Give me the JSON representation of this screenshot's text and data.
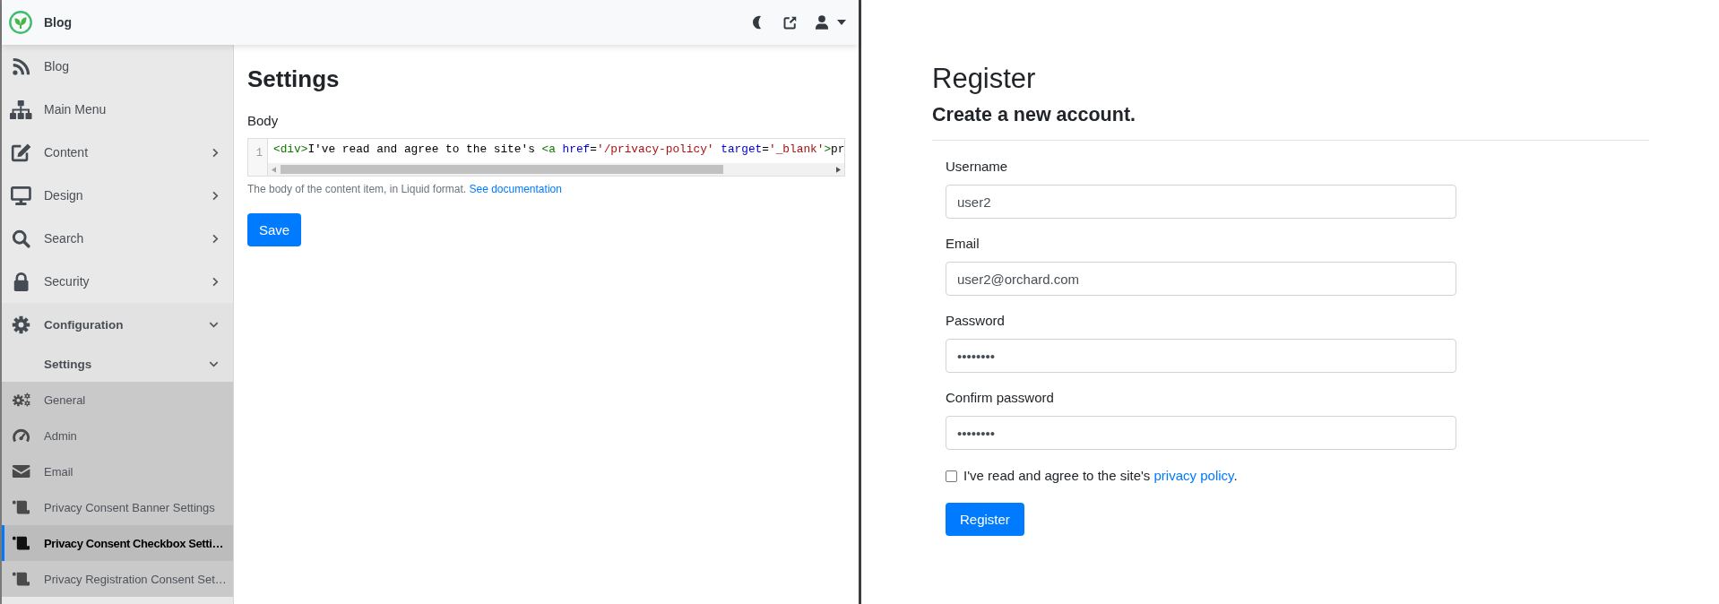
{
  "left_window": {
    "top_bar": {
      "title": "Blog"
    },
    "sidebar": {
      "items": [
        {
          "kind": "link",
          "label": "Blog",
          "selected": false
        },
        {
          "kind": "link",
          "label": "Main Menu",
          "selected": false
        },
        {
          "kind": "group",
          "label": "Content",
          "expanded": false
        },
        {
          "kind": "group",
          "label": "Design",
          "expanded": false
        },
        {
          "kind": "group",
          "label": "Search",
          "expanded": false
        },
        {
          "kind": "group",
          "label": "Security",
          "expanded": false
        },
        {
          "kind": "group",
          "label": "Configuration",
          "expanded": true,
          "children": [
            {
              "kind": "group",
              "label": "Settings",
              "expanded": true,
              "children": [
                {
                  "kind": "link",
                  "label": "General",
                  "selected": false
                },
                {
                  "kind": "link",
                  "label": "Admin",
                  "selected": false
                },
                {
                  "kind": "link",
                  "label": "Email",
                  "selected": false
                },
                {
                  "kind": "link",
                  "label": "Privacy Consent Banner Settings",
                  "selected": false
                },
                {
                  "kind": "link",
                  "label": "Privacy Consent Checkbox Setti…",
                  "selected": true
                },
                {
                  "kind": "link",
                  "label": "Privacy Registration Consent Set…",
                  "selected": false
                }
              ]
            }
          ]
        }
      ]
    },
    "main": {
      "title": "Settings",
      "field_label": "Body",
      "editor": {
        "line_number": "1",
        "tokens": [
          {
            "kind": "tag",
            "text": "<div>"
          },
          {
            "kind": "text",
            "text": "I've read and agree to the site's "
          },
          {
            "kind": "tag",
            "text": "<a"
          },
          {
            "kind": "attribute",
            "text": " href"
          },
          {
            "kind": "text",
            "text": "="
          },
          {
            "kind": "string",
            "text": "'/privacy-policy'"
          },
          {
            "kind": "attribute",
            "text": " target"
          },
          {
            "kind": "text",
            "text": "="
          },
          {
            "kind": "string",
            "text": "'_blank'"
          },
          {
            "kind": "tag",
            "text": ">"
          },
          {
            "kind": "text",
            "text": "pr"
          }
        ]
      },
      "hint": {
        "text": "The body of the content item, in Liquid format.",
        "link": "See documentation"
      },
      "save_button": "Save"
    }
  },
  "register_page": {
    "title": "Register",
    "subtitle": "Create a new account.",
    "fields": [
      {
        "label": "Username",
        "value": "user2"
      },
      {
        "label": "Email",
        "value": "user2@orchard.com"
      },
      {
        "label": "Password",
        "value": "••••••••"
      },
      {
        "label": "Confirm password",
        "value": "••••••••"
      }
    ],
    "consent": {
      "checked": false,
      "text": "I've read and agree to the site's",
      "link": "privacy policy",
      "after": "."
    },
    "register_button": "Register"
  }
}
